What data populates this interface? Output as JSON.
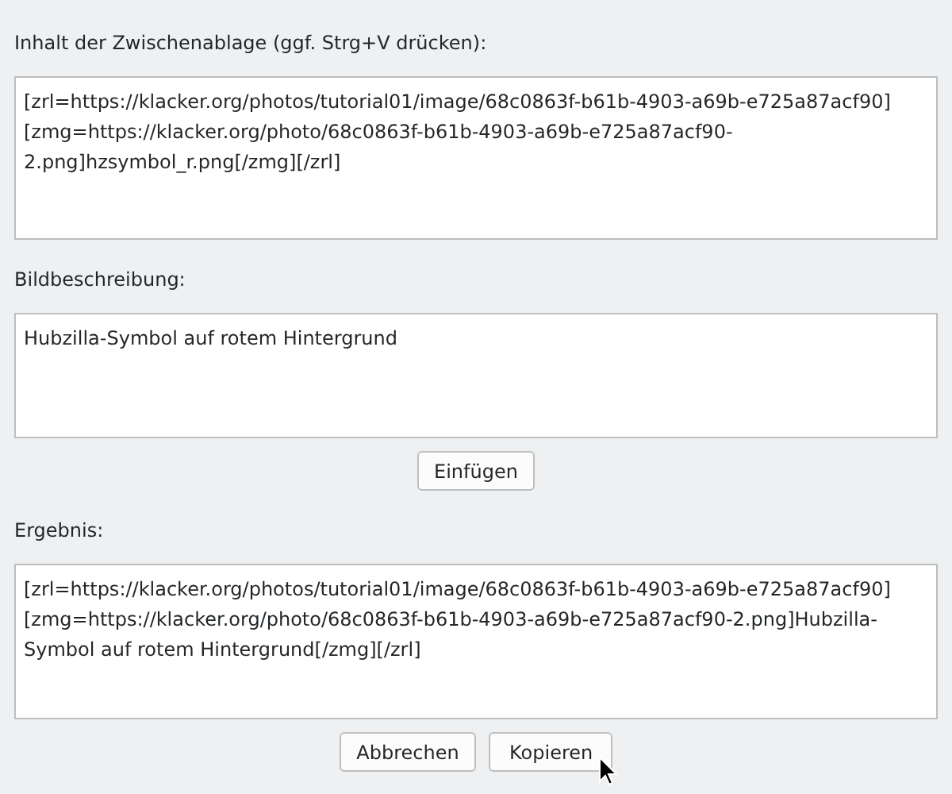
{
  "clipboard": {
    "label": "Inhalt der Zwischenablage (ggf. Strg+V drücken):",
    "value": "[zrl=https://klacker.org/photos/tutorial01/image/68c0863f-b61b-4903-a69b-e725a87acf90][zmg=https://klacker.org/photo/68c0863f-b61b-4903-a69b-e725a87acf90-2.png]hzsymbol_r.png[/zmg][/zrl]"
  },
  "description": {
    "label": "Bildbeschreibung:",
    "value": "Hubzilla-Symbol auf rotem Hintergrund"
  },
  "insert_button": "Einfügen",
  "result": {
    "label": "Ergebnis:",
    "value": "[zrl=https://klacker.org/photos/tutorial01/image/68c0863f-b61b-4903-a69b-e725a87acf90][zmg=https://klacker.org/photo/68c0863f-b61b-4903-a69b-e725a87acf90-2.png]Hubzilla-Symbol auf rotem Hintergrund[/zmg][/zrl]"
  },
  "buttons": [
    "Abbrechen",
    "Kopieren"
  ]
}
